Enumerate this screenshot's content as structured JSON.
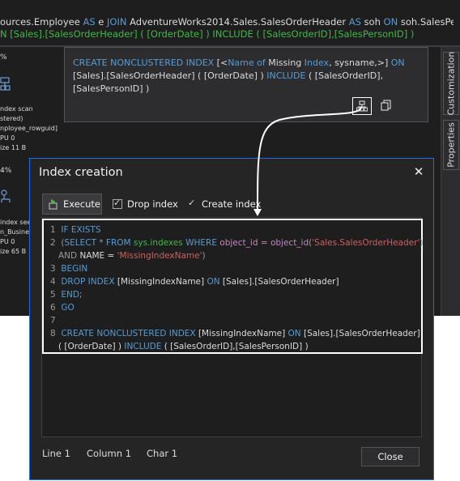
{
  "query": {
    "line1_a": "ources.Employee ",
    "line1_kw1": "AS",
    "line1_b": " e ",
    "line1_kw2": "JOIN",
    "line1_c": " AdventureWorks2014.Sales.SalesOrderHeader ",
    "line1_kw3": "AS",
    "line1_d": " soh ",
    "line1_kw4": "ON",
    "line1_e": " soh.SalesPersonID...",
    "line2": "N [Sales].[SalesOrderHeader] ( [OrderDate] ) INCLUDE ( [SalesOrderID],[SalesPersonID] )"
  },
  "plan": {
    "cost1": "%",
    "node1_lines": [
      "ndex scan",
      "stered)",
      "nployee_rowguid]",
      "PU  0",
      "ize  11 B"
    ],
    "cost2": "4%",
    "node2_lines": [
      "index see",
      "n_Busine",
      "PU  0",
      "ize  65 B"
    ]
  },
  "side_tabs": [
    "Customization",
    "Properties"
  ],
  "hint": {
    "kw_create": "CREATE NONCLUSTERED INDEX",
    "lt": " [<",
    "name_of": "Name of",
    "missing": " Missing ",
    "index_word": "Index",
    "sysname": ", sysname,>] ",
    "on": "ON",
    "line2_a": "[Sales].[SalesOrderHeader]  ( [OrderDate] ) ",
    "include": "INCLUDE",
    "line2_b": " ( [SalesOrderID],",
    "line3": "[SalesPersonID] )"
  },
  "dialog": {
    "title": "Index creation",
    "close_glyph": "✕",
    "execute_label": "Execute",
    "drop_index_label": "Drop index",
    "create_index_label": "Create index",
    "status_line": "Line 1",
    "status_column": "Column 1",
    "status_char": "Char 1",
    "close_button_label": "Close"
  },
  "code": {
    "numbers": [
      "1",
      "2",
      "3",
      "4",
      "5",
      "6",
      "7",
      "8"
    ],
    "l1_kw": "IF EXISTS",
    "l2_open": "(",
    "l2_select": "SELECT",
    "l2_star": " * ",
    "l2_from": "FROM",
    "l2_sys": " sys.indexes ",
    "l2_where": "WHERE",
    "l2_obj": " object_id = object_id",
    "l2_paren": "(",
    "l2_str": "'Sales.SalesOrderHeader'",
    "l2_close": ")",
    "l2b_and": "AND",
    "l2b_name": " NAME = ",
    "l2b_str": "'MissingIndexName'",
    "l2b_close": ")",
    "l3_kw": "BEGIN",
    "l4_kw1": "DROP INDEX",
    "l4_name": " [MissingIndexName] ",
    "l4_on": "ON",
    "l4_tbl": " [Sales].[SalesOrderHeader]",
    "l5_kw": "END",
    "l5_semi": ";",
    "l6_kw": "GO",
    "l8_kw": "CREATE NONCLUSTERED INDEX",
    "l8_name": " [MissingIndexName] ",
    "l8_on": "ON",
    "l8_tbl": " [Sales].[SalesOrderHeader]",
    "l8b_a": "( [OrderDate] ) ",
    "l8b_include": "INCLUDE",
    "l8b_b": " ( [SalesOrderID],[SalesPersonID] )"
  },
  "colors": {
    "keyword": "#569cd6",
    "sys_object": "#3fb949",
    "function": "#c586c0",
    "string": "#ce6060",
    "dialog_border": "#1f6feb"
  }
}
